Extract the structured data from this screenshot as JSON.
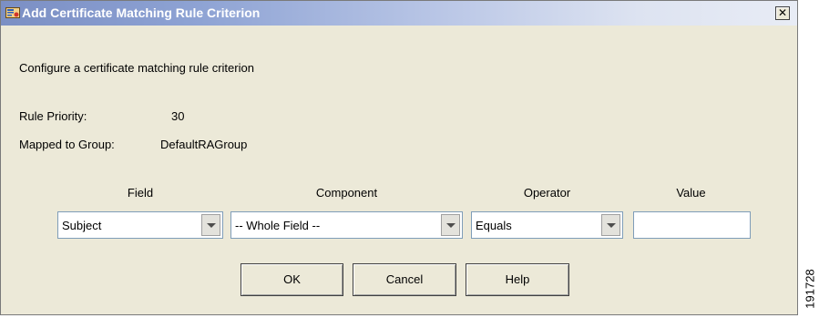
{
  "dialog": {
    "title": "Add Certificate Matching Rule Criterion",
    "close_label": "✕",
    "description": "Configure a certificate matching rule criterion",
    "rule_priority_label": "Rule Priority:",
    "rule_priority_value": "30",
    "mapped_group_label": "Mapped to Group:",
    "mapped_group_value": "DefaultRAGroup"
  },
  "criteria": {
    "headers": {
      "field": "Field",
      "component": "Component",
      "operator": "Operator",
      "value": "Value"
    },
    "field_selected": "Subject",
    "component_selected": "-- Whole Field --",
    "operator_selected": "Equals",
    "value_text": ""
  },
  "buttons": {
    "ok": "OK",
    "cancel": "Cancel",
    "help": "Help"
  },
  "figure_id": "191728",
  "icons": {
    "title": "certificate-icon",
    "close": "close-icon",
    "dropdown": "chevron-down-icon"
  }
}
